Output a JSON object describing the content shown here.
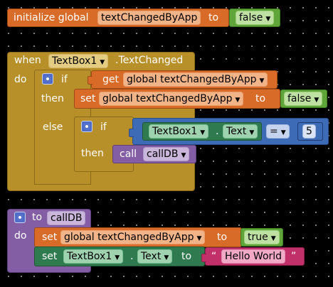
{
  "global_decl": {
    "label": "initialize global",
    "var_name": "textChangedByApp",
    "to_label": "to",
    "value": "false"
  },
  "event_block": {
    "when_label": "when",
    "component": "TextBox1",
    "event": ".TextChanged",
    "do_label": "do",
    "if_label": "if",
    "get_label": "get",
    "get_var": "global textChangedByApp",
    "then_label": "then",
    "set_label": "set",
    "set_var": "global textChangedByApp",
    "to_label": "to",
    "set_value": "false",
    "else_label": "else",
    "inner_if_label": "if",
    "cmp_component": "TextBox1",
    "cmp_dot": ".",
    "cmp_prop": "Text",
    "cmp_op": "=",
    "cmp_number": "5",
    "inner_then_label": "then",
    "call_label": "call",
    "call_proc": "callDB"
  },
  "procedure": {
    "to_label": "to",
    "name": "callDB",
    "do_label": "do",
    "set1_label": "set",
    "set1_var": "global textChangedByApp",
    "set1_to": "to",
    "set1_value": "true",
    "set2_label": "set",
    "set2_component": "TextBox1",
    "set2_dot": ".",
    "set2_prop": "Text",
    "set2_to": "to",
    "quote_open": "“",
    "string_value": "Hello World",
    "quote_close": "”"
  },
  "colors": {
    "variables": "#d86b28",
    "logic": "#5fa53a",
    "control_event": "#b8902a",
    "math_compare": "#3d6bb5",
    "procedures": "#845ea4",
    "component_props": "#2f7a4f",
    "text": "#c2306a"
  },
  "icons": [
    "mutator-gear-icon",
    "dropdown-caret-icon"
  ]
}
